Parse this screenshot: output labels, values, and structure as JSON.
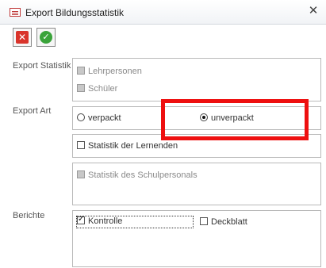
{
  "window": {
    "title": "Export Bildungsstatistik",
    "close_glyph": "✕"
  },
  "toolbar": {
    "cancel_icon": "close-icon",
    "confirm_icon": "check-icon",
    "cancel_glyph": "✕",
    "confirm_glyph": "✓"
  },
  "export_statistik": {
    "label": "Export Statistik",
    "options": [
      {
        "label": "Lehrpersonen",
        "checked": false,
        "enabled": false
      },
      {
        "label": "Schüler",
        "checked": false,
        "enabled": false
      }
    ]
  },
  "export_art": {
    "label": "Export Art",
    "radios": [
      {
        "label": "verpackt",
        "selected": false
      },
      {
        "label": "unverpackt",
        "selected": true
      }
    ],
    "statistik_lernende": {
      "label": "Statistik der Lernenden",
      "checked": false,
      "enabled": true
    },
    "statistik_schulpersonal": {
      "label": "Statistik des Schulpersonals",
      "checked": false,
      "enabled": false
    }
  },
  "berichte": {
    "label": "Berichte",
    "options": [
      {
        "label": "Kontrolle",
        "checked": true
      },
      {
        "label": "Deckblatt",
        "checked": false
      }
    ]
  },
  "annotation": {
    "color": "#ee0f0f"
  }
}
